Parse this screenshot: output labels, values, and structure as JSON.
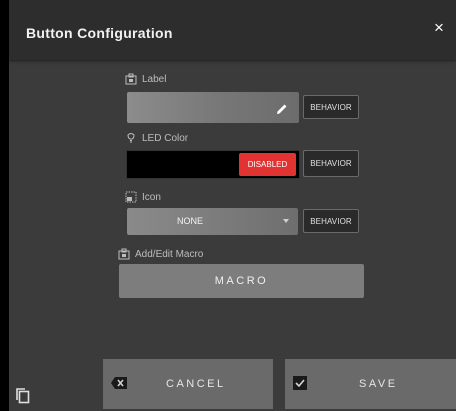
{
  "dialog": {
    "title": "Button Configuration",
    "close_glyph": "×"
  },
  "label_section": {
    "heading": "Label",
    "icon": "label-tag-icon",
    "value": "",
    "edit_icon": "pencil-icon",
    "behavior_label": "BEHAVIOR"
  },
  "led_section": {
    "heading": "LED Color",
    "icon": "bulb-icon",
    "color_value": "#000000",
    "status_badge": "DISABLED",
    "status_color": "#e23333",
    "behavior_label": "BEHAVIOR"
  },
  "icon_section": {
    "heading": "Icon",
    "icon": "image-frame-icon",
    "selected": "NONE",
    "behavior_label": "BEHAVIOR"
  },
  "macro_section": {
    "heading": "Add/Edit Macro",
    "icon": "macro-tag-icon",
    "button_label": "MACRO"
  },
  "footer": {
    "cancel_label": "CANCEL",
    "cancel_icon": "backspace-icon",
    "save_label": "SAVE",
    "save_icon": "checkbox-icon",
    "copy_icon": "copy-icon"
  }
}
